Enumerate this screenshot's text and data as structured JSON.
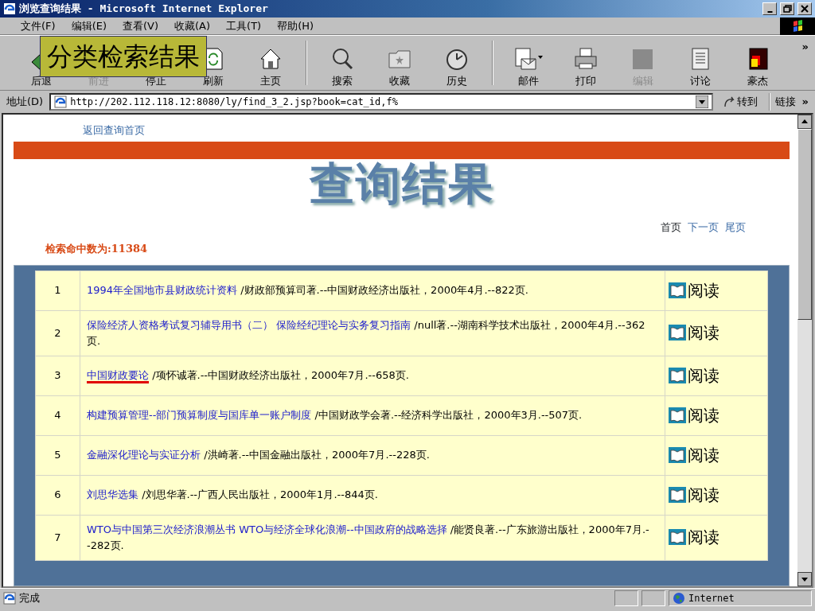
{
  "window": {
    "title": "浏览查询结果 - Microsoft Internet Explorer"
  },
  "menu": [
    "文件(F)",
    "编辑(E)",
    "查看(V)",
    "收藏(A)",
    "工具(T)",
    "帮助(H)"
  ],
  "toolbar": {
    "groups": [
      [
        {
          "label": "后退",
          "kind": "back",
          "disabled": false
        },
        {
          "label": "前进",
          "kind": "forward",
          "disabled": true
        },
        {
          "label": "停止",
          "kind": "stop",
          "disabled": false
        },
        {
          "label": "刷新",
          "kind": "refresh",
          "disabled": false
        },
        {
          "label": "主页",
          "kind": "home",
          "disabled": false
        }
      ],
      [
        {
          "label": "搜索",
          "kind": "search",
          "disabled": false
        },
        {
          "label": "收藏",
          "kind": "favorites",
          "disabled": false
        },
        {
          "label": "历史",
          "kind": "history",
          "disabled": false
        }
      ],
      [
        {
          "label": "邮件",
          "kind": "mail",
          "disabled": false
        },
        {
          "label": "打印",
          "kind": "print",
          "disabled": false
        },
        {
          "label": "编辑",
          "kind": "edit",
          "disabled": true
        },
        {
          "label": "讨论",
          "kind": "discuss",
          "disabled": false
        },
        {
          "label": "豪杰",
          "kind": "app",
          "disabled": false
        }
      ]
    ],
    "more": "»"
  },
  "address": {
    "label": "地址(D)",
    "url": "http://202.112.118.12:8080/ly/find_3_2.jsp?book=cat_id,f%",
    "go": "转到",
    "links": "链接",
    "links_more": "»"
  },
  "page": {
    "back_link": "返回查询首页",
    "heading": "查询结果",
    "pager": [
      {
        "label": "首页",
        "disabled": true
      },
      {
        "label": "下一页",
        "disabled": false
      },
      {
        "label": "尾页",
        "disabled": false
      }
    ],
    "hit_count": "检索命中数为:11384",
    "rows": [
      {
        "number": "1",
        "title": "1994年全国地市县财政统计资料",
        "rest": " /财政部预算司著.--中国财政经济出版社，2000年4月.--822页.",
        "underlined": false,
        "action": "阅读"
      },
      {
        "number": "2",
        "title": "保险经济人资格考试复习辅导用书（二） 保险经纪理论与实务复习指南",
        "rest": " /null著.--湖南科学技术出版社，2000年4月.--362页.",
        "underlined": false,
        "action": "阅读"
      },
      {
        "number": "3",
        "title": "中国财政要论",
        "rest": " /项怀诚著.--中国财政经济出版社，2000年7月.--658页.",
        "underlined": true,
        "action": "阅读"
      },
      {
        "number": "4",
        "title": "构建预算管理--部门预算制度与国库单一账户制度",
        "rest": " /中国财政学会著.--经济科学出版社，2000年3月.--507页.",
        "underlined": false,
        "action": "阅读"
      },
      {
        "number": "5",
        "title": "金融深化理论与实证分析",
        "rest": " /洪崎著.--中国金融出版社，2000年7月.--228页.",
        "underlined": false,
        "action": "阅读"
      },
      {
        "number": "6",
        "title": "刘思华选集",
        "rest": " /刘思华著.--广西人民出版社，2000年1月.--844页.",
        "underlined": false,
        "action": "阅读"
      },
      {
        "number": "7",
        "title": "WTO与中国第三次经济浪潮丛书 WTO与经济全球化浪潮--中国政府的战略选择",
        "rest": " /能贤良著.--广东旅游出版社，2000年7月.--282页.",
        "underlined": false,
        "action": "阅读"
      }
    ]
  },
  "status_bar": {
    "text": "完成",
    "zone": "Internet"
  },
  "slide_label": "分类检索结果"
}
